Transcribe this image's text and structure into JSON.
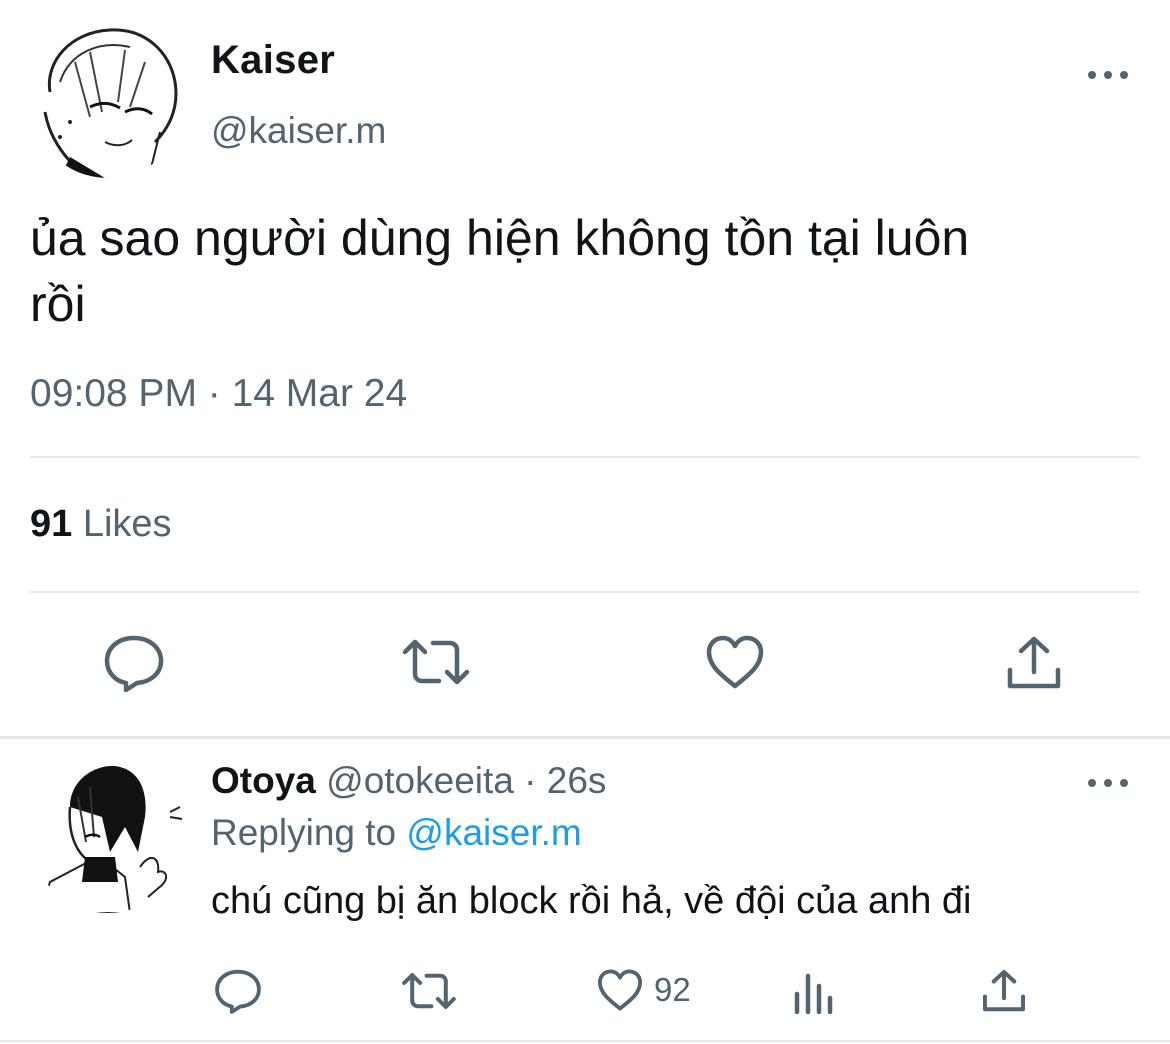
{
  "main_tweet": {
    "name": "Kaiser",
    "handle": "@kaiser.m",
    "text_line1": "ủa sao người dùng hiện không tồn tại luôn",
    "text_line2": "rồi",
    "timestamp": "09:08 PM · 14 Mar 24",
    "likes_count": "91",
    "likes_label": " Likes",
    "icons": [
      "reply-icon",
      "retweet-icon",
      "like-icon",
      "share-icon",
      "more-icon"
    ]
  },
  "reply_tweet": {
    "name": "Otoya",
    "handle_time": " @otokeeita · 26s",
    "replying_prefix": "Replying to ",
    "replying_handle": "@kaiser.m",
    "text": "chú cũng bị ăn block rồi hả, về đội của anh đi",
    "like_count": "92",
    "icons": [
      "reply-icon",
      "retweet-icon",
      "like-icon",
      "stats-icon",
      "share-icon",
      "more-icon"
    ]
  },
  "colors": {
    "text": "#0f1419",
    "secondary": "#536471",
    "link": "#1d9bf0",
    "divider": "#e6e9ec"
  }
}
